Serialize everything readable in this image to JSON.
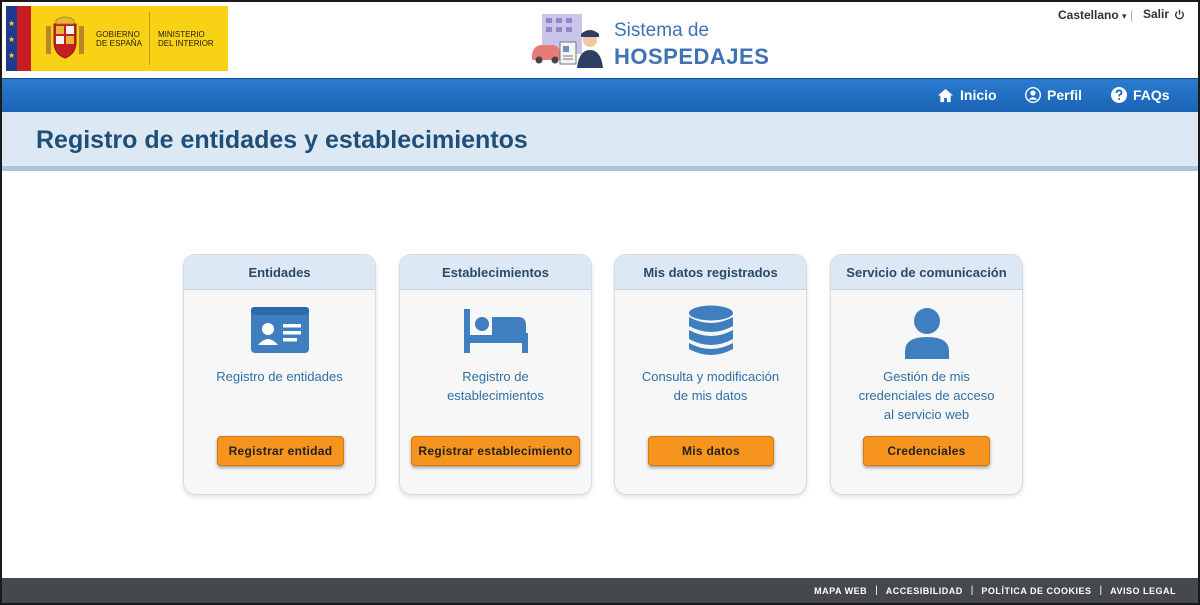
{
  "header": {
    "gov_logo": {
      "line1": "GOBIERNO",
      "line2": "DE ESPAÑA",
      "ministry_line1": "MINISTERIO",
      "ministry_line2": "DEL INTERIOR"
    },
    "brand_line1": "Sistema de",
    "brand_line2": "HOSPEDAJES",
    "language": "Castellano",
    "logout": "Salir"
  },
  "nav": {
    "items": [
      {
        "label": "Inicio",
        "icon": "home-icon"
      },
      {
        "label": "Perfil",
        "icon": "user-circle-icon"
      },
      {
        "label": "FAQs",
        "icon": "question-circle-icon"
      }
    ]
  },
  "page": {
    "title": "Registro de entidades y establecimientos"
  },
  "cards": [
    {
      "title": "Entidades",
      "icon": "id-card-icon",
      "desc_line1": "Registro de entidades",
      "desc_line2": "",
      "desc_line3": "",
      "button": "Registrar entidad"
    },
    {
      "title": "Establecimientos",
      "icon": "bed-icon",
      "desc_line1": "Registro de",
      "desc_line2": "establecimientos",
      "desc_line3": "",
      "button": "Registrar establecimiento"
    },
    {
      "title": "Mis datos registrados",
      "icon": "database-icon",
      "desc_line1": "Consulta y modificación",
      "desc_line2": "de mis datos",
      "desc_line3": "",
      "button": "Mis datos"
    },
    {
      "title": "Servicio de comunicación",
      "icon": "user-icon",
      "desc_line1": "Gestión de mis",
      "desc_line2": "credenciales de acceso",
      "desc_line3": "al servicio web",
      "button": "Credenciales"
    }
  ],
  "footer": {
    "links": [
      "MAPA WEB",
      "ACCESIBILIDAD",
      "POLÍTICA DE COOKIES",
      "AVISO LEGAL"
    ]
  },
  "colors": {
    "nav_blue": "#1a63b4",
    "title_blue": "#1f4e79",
    "button_orange": "#f7941d",
    "footer_gray": "#46494c"
  }
}
